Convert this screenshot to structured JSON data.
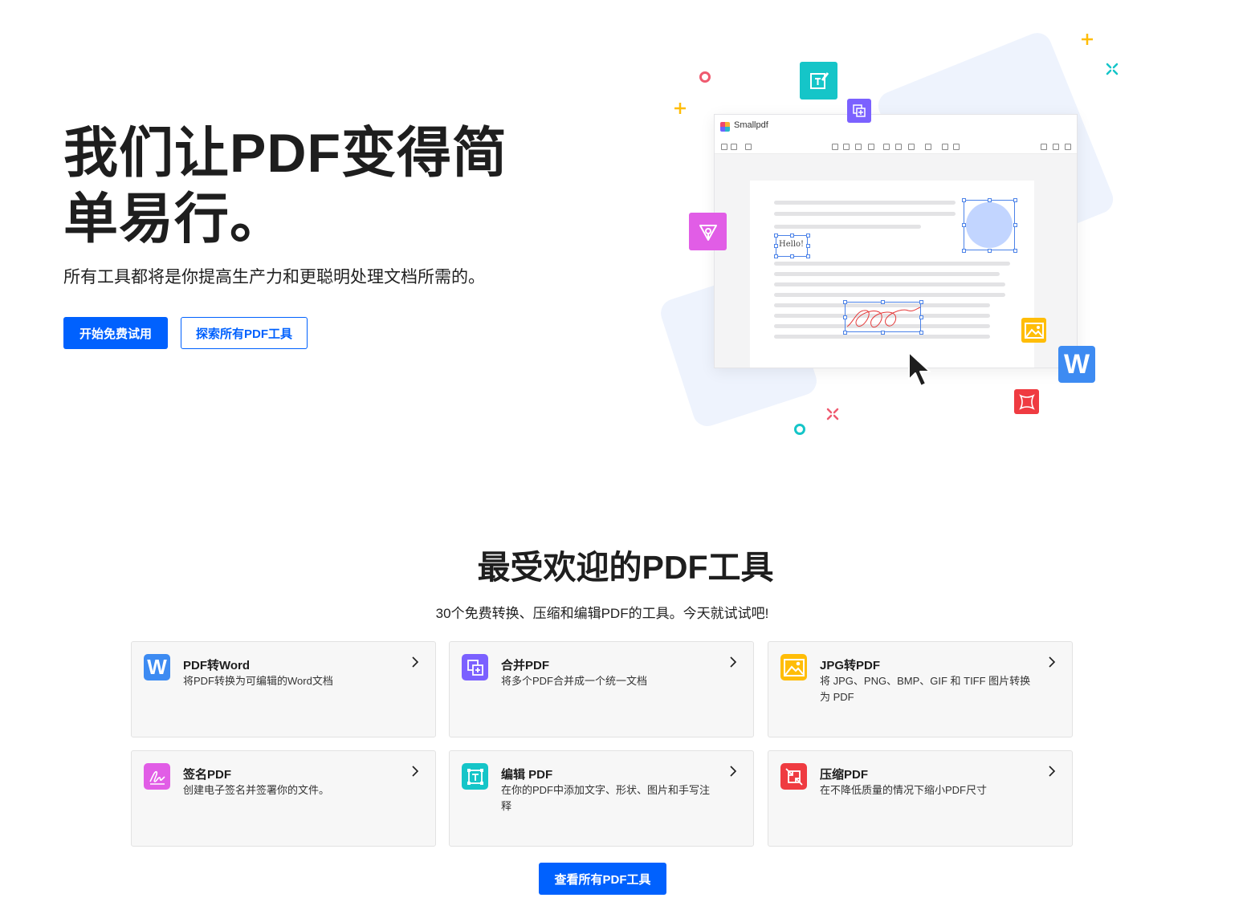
{
  "hero": {
    "title": "我们让PDF变得简单易行。",
    "subtitle": "所有工具都将是你提高生产力和更聪明处理文档所需的。",
    "primary_button": "开始免费试用",
    "secondary_button": "探索所有PDF工具"
  },
  "illustration": {
    "app_name": "Smallpdf",
    "sample_text": "Hello!"
  },
  "tools_section": {
    "title": "最受欢迎的PDF工具",
    "subtitle": "30个免费转换、压缩和编辑PDF的工具。今天就试试吧!",
    "view_all_button": "查看所有PDF工具",
    "tools": [
      {
        "title": "PDF转Word",
        "desc": "将PDF转换为可编辑的Word文档",
        "icon": "word-icon",
        "color": "#3d8bf2"
      },
      {
        "title": "合并PDF",
        "desc": "将多个PDF合并成一个统一文档",
        "icon": "merge-icon",
        "color": "#7b61ff"
      },
      {
        "title": "JPG转PDF",
        "desc": "将 JPG、PNG、BMP、GIF 和 TIFF 图片转换为 PDF",
        "icon": "image-icon",
        "color": "#ffbd07"
      },
      {
        "title": "签名PDF",
        "desc": "创建电子签名并签署你的文件。",
        "icon": "signature-icon",
        "color": "#e15de6"
      },
      {
        "title": "编辑 PDF",
        "desc": "在你的PDF中添加文字、形状、图片和手写注释",
        "icon": "edit-icon",
        "color": "#15c5c8"
      },
      {
        "title": "压缩PDF",
        "desc": "在不降低质量的情况下缩小PDF尺寸",
        "icon": "compress-icon",
        "color": "#ef3b41"
      }
    ]
  },
  "colors": {
    "accent": "#0061fe"
  }
}
